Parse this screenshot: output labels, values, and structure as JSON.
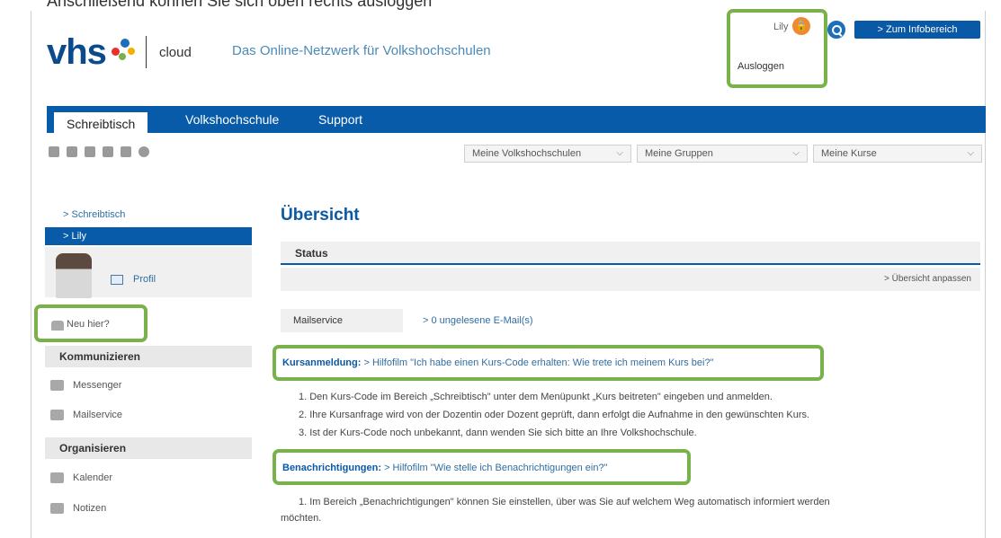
{
  "top_strip_text": "Anschließend können Sie sich oben rechts ausloggen",
  "header": {
    "logo_text": "vhs",
    "logo_cloud": "cloud",
    "tagline": "Das Online-Netzwerk für Volkshochschulen",
    "user_name": "Lily",
    "logout_label": "Ausloggen",
    "info_button": "> Zum Infobereich"
  },
  "nav": {
    "tabs": [
      {
        "label": "Schreibtisch"
      },
      {
        "label": "Volkshochschule"
      },
      {
        "label": "Support"
      }
    ]
  },
  "selects": [
    {
      "label": "Meine Volkshochschulen"
    },
    {
      "label": "Meine Gruppen"
    },
    {
      "label": "Meine Kurse"
    }
  ],
  "sidebar": {
    "crumb": "> Schreibtisch",
    "user": "> Lily",
    "profile": "Profil",
    "neu_hier": "Neu hier?",
    "kommunizieren": "Kommunizieren",
    "messenger": "Messenger",
    "mailservice": "Mailservice",
    "organisieren": "Organisieren",
    "kalender": "Kalender",
    "notizen": "Notizen"
  },
  "main": {
    "title": "Übersicht",
    "status": "Status",
    "adjust": "> Übersicht anpassen",
    "mail_label": "Mailservice",
    "mail_value": "> 0 ungelesene E-Mail(s)",
    "kurs_label": "Kursanmeldung:",
    "kurs_link": "> Hilfofilm \"Ich habe einen Kurs-Code erhalten: Wie trete ich meinem Kurs bei?\"",
    "steps": [
      "1. Den Kurs-Code im Bereich „Schreibtisch\" unter dem Menüpunkt „Kurs beitreten\" eingeben und anmelden.",
      "2. Ihre Kursanfrage wird von der Dozentin oder Dozent geprüft, dann erfolgt die Aufnahme in den gewünschten Kurs.",
      "3. Ist der Kurs-Code noch unbekannt, dann wenden Sie sich bitte an Ihre Volkshochschule."
    ],
    "benach_label": "Benachrichtigungen:",
    "benach_link": "> Hilfofilm \"Wie stelle ich Benachrichtigungen ein?\"",
    "benach_step": "1. Im Bereich „Benachrichtigungen\" können Sie einstellen, über was Sie auf welchem Weg automatisch informiert werden",
    "benach_step2": "möchten."
  }
}
